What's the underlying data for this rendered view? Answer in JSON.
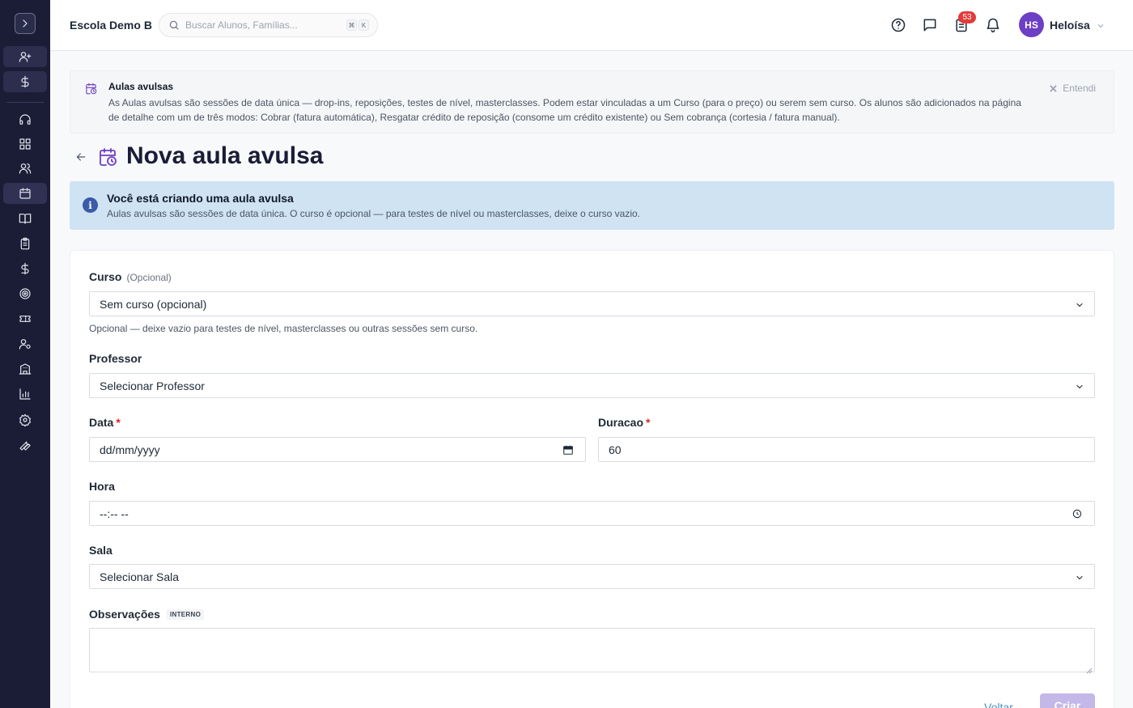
{
  "header": {
    "school_name": "Escola Demo B",
    "search_placeholder": "Buscar Alunos, Famílias...",
    "shortcut_keys": [
      "⌘",
      "K"
    ],
    "notification_count": "53",
    "user_initials": "HS",
    "user_name": "Heloísa"
  },
  "sidebar": {
    "icons": [
      "chevron-right-icon",
      "user-plus-icon",
      "dollar-icon",
      "headset-icon",
      "grid-icon",
      "users-icon",
      "calendar-icon",
      "book-icon",
      "clipboard-icon",
      "dollar-icon",
      "target-icon",
      "ticket-icon",
      "user-cog-icon",
      "building-icon",
      "chart-icon",
      "gear-icon",
      "wrench-icon"
    ],
    "active": "calendar-icon"
  },
  "tip": {
    "title": "Aulas avulsas",
    "body": "As Aulas avulsas são sessões de data única — drop-ins, reposições, testes de nível, masterclasses. Podem estar vinculadas a um Curso (para o preço) ou serem sem curso. Os alunos são adicionados na página de detalhe com um de três modos: Cobrar (fatura automática), Resgatar crédito de reposição (consome um crédito existente) ou Sem cobrança (cortesia / fatura manual).",
    "dismiss_label": "Entendi"
  },
  "page": {
    "title": "Nova aula avulsa"
  },
  "info": {
    "title": "Você está criando uma aula avulsa",
    "body": "Aulas avulsas são sessões de data única. O curso é opcional — para testes de nível ou masterclasses, deixe o curso vazio."
  },
  "form": {
    "curso": {
      "label": "Curso",
      "optional_tag": "(Opcional)",
      "value": "Sem curso (opcional)",
      "help": "Opcional — deixe vazio para testes de nível, masterclasses ou outras sessões sem curso."
    },
    "professor": {
      "label": "Professor",
      "value": "Selecionar Professor"
    },
    "data": {
      "label": "Data",
      "required": "*",
      "placeholder": "dd/mm/yyyy"
    },
    "duracao": {
      "label": "Duracao",
      "required": "*",
      "value": "60"
    },
    "hora": {
      "label": "Hora",
      "placeholder": "--:-- --"
    },
    "sala": {
      "label": "Sala",
      "value": "Selecionar Sala"
    },
    "observacoes": {
      "label": "Observações",
      "tag": "INTERNO"
    }
  },
  "actions": {
    "back_label": "Voltar",
    "create_label": "Criar"
  },
  "colors": {
    "sidebar_bg": "#1b1d36",
    "accent": "#6d3fc4",
    "info_bg": "#cfe3f3",
    "badge": "#e23b3b",
    "required": "#dc2626"
  }
}
